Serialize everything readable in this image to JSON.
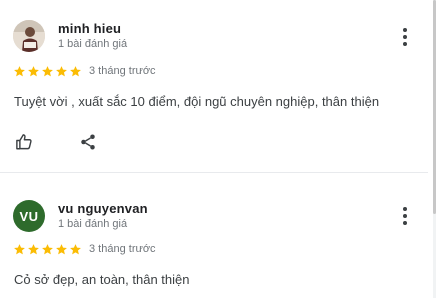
{
  "reviews": [
    {
      "name": "minh hieu",
      "review_count": "1 bài đánh giá",
      "rating": 5,
      "time": "3 tháng trước",
      "text": "Tuyệt vời , xuất sắc 10 điểm, đội ngũ chuyên nghiệp, thân thiện",
      "avatar": "photo"
    },
    {
      "name": "vu nguyenvan",
      "review_count": "1 bài đánh giá",
      "rating": 5,
      "time": "3 tháng trước",
      "text": "Cỏ sở đẹp, an toàn, thân thiện",
      "avatar_initials": "VU",
      "avatar_color": "#2e6b2c"
    }
  ],
  "colors": {
    "star": "#fbbc04",
    "text": "#3c4043",
    "meta": "#70757a"
  },
  "icons": [
    "thumbs-up-icon",
    "share-icon",
    "more-vert-icon",
    "star-icon"
  ]
}
